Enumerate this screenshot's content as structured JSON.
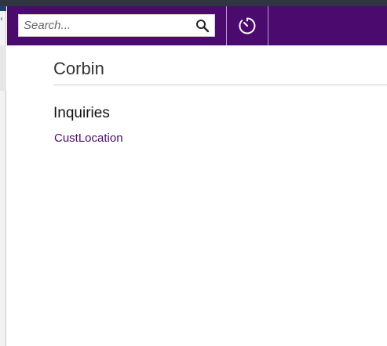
{
  "header": {
    "search": {
      "placeholder": "Search..."
    },
    "background_color": "#4b0b6e"
  },
  "page": {
    "title": "Corbin",
    "section": {
      "title": "Inquiries",
      "links": [
        "CustLocation"
      ]
    }
  },
  "icons": {
    "search": "search-icon",
    "timer": "timer-icon"
  },
  "colors": {
    "accent": "#4b0b6e",
    "link": "#4b0b6e"
  }
}
